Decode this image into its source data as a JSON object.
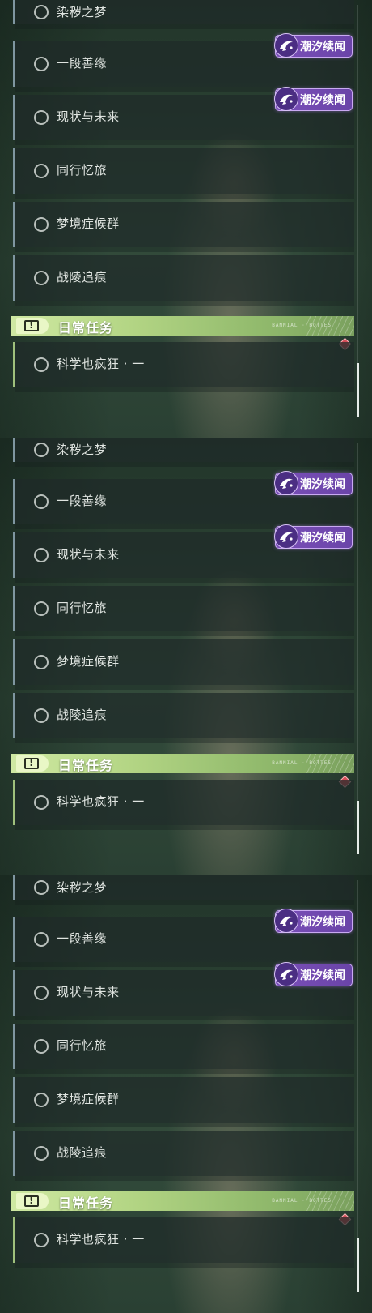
{
  "panels": [
    {
      "quests": [
        {
          "label": "染秽之梦"
        },
        {
          "label": "一段善缘"
        },
        {
          "label": "现状与未来"
        },
        {
          "label": "同行忆旅"
        },
        {
          "label": "梦境症候群"
        },
        {
          "label": "战陵追痕"
        }
      ],
      "badges": [
        {
          "label": "潮汐续闻"
        },
        {
          "label": "潮汐续闻"
        }
      ],
      "section": {
        "title": "日常任务",
        "deco": "BANNIAL · BOTTES"
      },
      "daily_quests": [
        {
          "label": "科学也疯狂 · 一"
        }
      ]
    },
    {
      "quests": [
        {
          "label": "染秽之梦"
        },
        {
          "label": "一段善缘"
        },
        {
          "label": "现状与未来"
        },
        {
          "label": "同行忆旅"
        },
        {
          "label": "梦境症候群"
        },
        {
          "label": "战陵追痕"
        }
      ],
      "badges": [
        {
          "label": "潮汐续闻"
        },
        {
          "label": "潮汐续闻"
        }
      ],
      "section": {
        "title": "日常任务",
        "deco": "BANNIAL · BOTTES"
      },
      "daily_quests": [
        {
          "label": "科学也疯狂 · 一"
        }
      ]
    },
    {
      "quests": [
        {
          "label": "染秽之梦"
        },
        {
          "label": "一段善缘"
        },
        {
          "label": "现状与未来"
        },
        {
          "label": "同行忆旅"
        },
        {
          "label": "梦境症候群"
        },
        {
          "label": "战陵追痕"
        }
      ],
      "badges": [
        {
          "label": "潮汐续闻"
        },
        {
          "label": "潮汐续闻"
        }
      ],
      "section": {
        "title": "日常任务",
        "deco": "BANNIAL · BOTTES"
      },
      "daily_quests": [
        {
          "label": "科学也疯狂 · 一"
        }
      ]
    }
  ],
  "icons": {
    "badge": "tidal-wave-icon",
    "section": "exclamation-box-icon",
    "tracked": "diamond-marker-icon",
    "quest_status": "ring-icon"
  },
  "colors": {
    "badge_purple": "#7a4fb8",
    "section_green": "#b3d584",
    "marker_red": "#d44c56"
  }
}
